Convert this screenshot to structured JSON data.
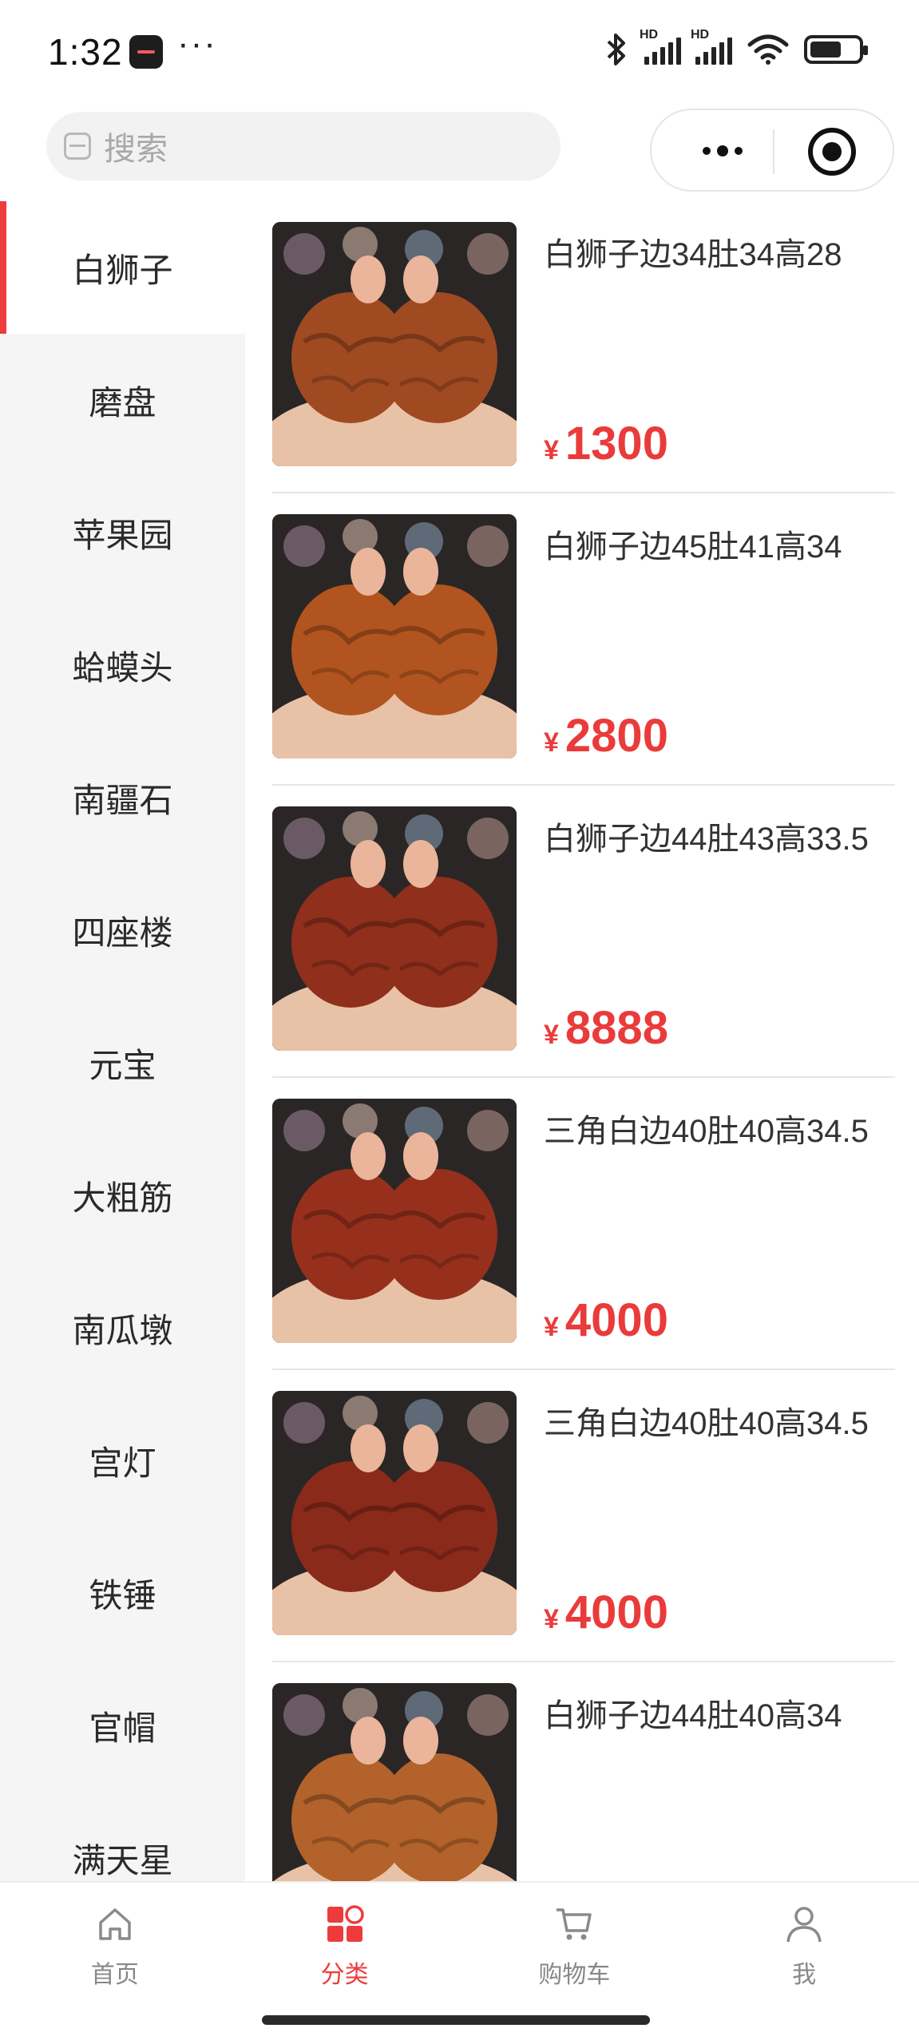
{
  "status_bar": {
    "time": "1:32",
    "more": "···",
    "battery_level": 0.65,
    "icons": [
      "bluetooth-icon",
      "signal-hd-icon",
      "signal-hd-icon",
      "wifi-icon",
      "battery-icon"
    ]
  },
  "search": {
    "placeholder": "搜索"
  },
  "capsule": {
    "icons": [
      "more-icon",
      "close-miniprogram-icon"
    ]
  },
  "sidebar": {
    "active_index": 0,
    "items": [
      {
        "label": "白狮子"
      },
      {
        "label": "磨盘"
      },
      {
        "label": "苹果园"
      },
      {
        "label": "蛤蟆头"
      },
      {
        "label": "南疆石"
      },
      {
        "label": "四座楼"
      },
      {
        "label": "元宝"
      },
      {
        "label": "大粗筋"
      },
      {
        "label": "南瓜墩"
      },
      {
        "label": "宫灯"
      },
      {
        "label": "铁锤"
      },
      {
        "label": "官帽"
      },
      {
        "label": "满天星"
      }
    ]
  },
  "products": [
    {
      "title": "白狮子边34肚34高28",
      "currency": "¥",
      "price": "1300",
      "tone": "#a04a22"
    },
    {
      "title": "白狮子边45肚41高34",
      "currency": "¥",
      "price": "2800",
      "tone": "#b2541f"
    },
    {
      "title": "白狮子边44肚43高33.5",
      "currency": "¥",
      "price": "8888",
      "tone": "#8f2f1c"
    },
    {
      "title": "三角白边40肚40高34.5",
      "currency": "¥",
      "price": "4000",
      "tone": "#96301d"
    },
    {
      "title": "三角白边40肚40高34.5",
      "currency": "¥",
      "price": "4000",
      "tone": "#8a2a1a"
    },
    {
      "title": "白狮子边44肚40高34",
      "currency": "¥",
      "price": "",
      "tone": "#b2622a"
    }
  ],
  "tabbar": {
    "accent": "#ee3b3b",
    "items": [
      {
        "label": "首页",
        "icon": "home-icon",
        "active": false
      },
      {
        "label": "分类",
        "icon": "category-icon",
        "active": true
      },
      {
        "label": "购物车",
        "icon": "cart-icon",
        "active": false
      },
      {
        "label": "我",
        "icon": "profile-icon",
        "active": false
      }
    ]
  }
}
